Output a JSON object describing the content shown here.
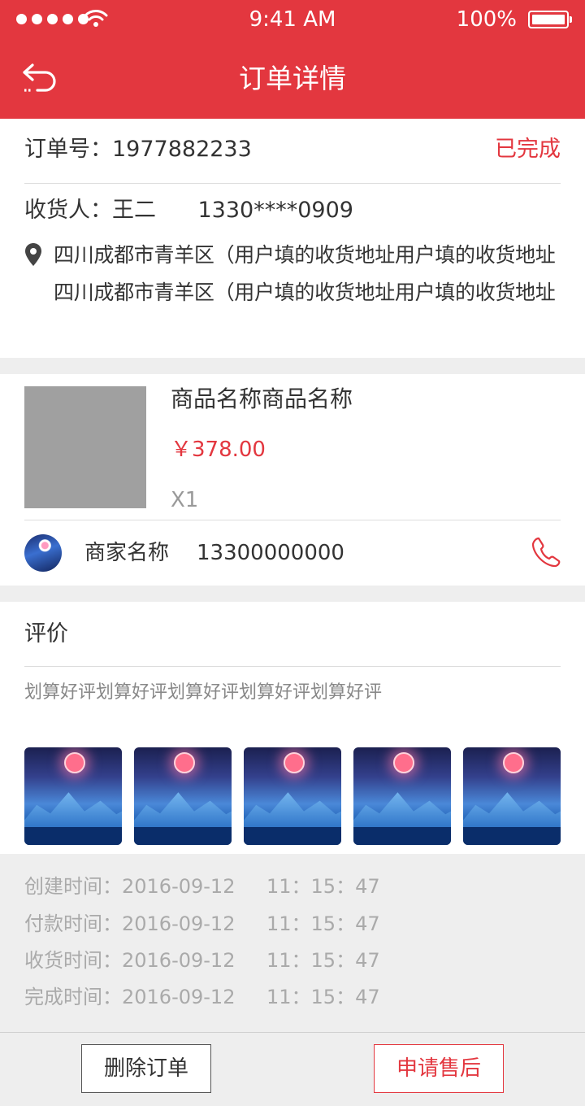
{
  "status_bar": {
    "time": "9:41 AM",
    "battery": "100%"
  },
  "nav": {
    "title": "订单详情"
  },
  "order": {
    "number_label": "订单号：1977882233",
    "status": "已完成",
    "consignee": "收货人：王二      1330****0909",
    "address": "四川成都市青羊区（用户填的收货地址用户填的收货地址四川成都市青羊区（用户填的收货地址用户填的收货地址"
  },
  "product": {
    "name": "商品名称商品名称",
    "price": "￥378.00",
    "quantity": "X1"
  },
  "merchant": {
    "name": "商家名称",
    "phone": "13300000000"
  },
  "review": {
    "title": "评价",
    "text": "划算好评划算好评划算好评划算好评划算好评",
    "photo_count": 5
  },
  "timeline": [
    {
      "label_date": "创建时间：2016-09-12",
      "clock": "11：15：47"
    },
    {
      "label_date": "付款时间：2016-09-12",
      "clock": "11：15：47"
    },
    {
      "label_date": "收货时间：2016-09-12",
      "clock": "11：15：47"
    },
    {
      "label_date": "完成时间：2016-09-12",
      "clock": "11：15：47"
    }
  ],
  "actions": {
    "delete_label": "删除订单",
    "aftersale_label": "申请售后"
  },
  "colors": {
    "brand": "#e3373f",
    "background": "#eeeeee"
  },
  "icons": {
    "back": "back-arrow-icon",
    "location": "location-pin-icon",
    "call": "phone-icon",
    "wifi": "wifi-icon",
    "battery": "battery-icon",
    "signal": "signal-dots-icon"
  }
}
